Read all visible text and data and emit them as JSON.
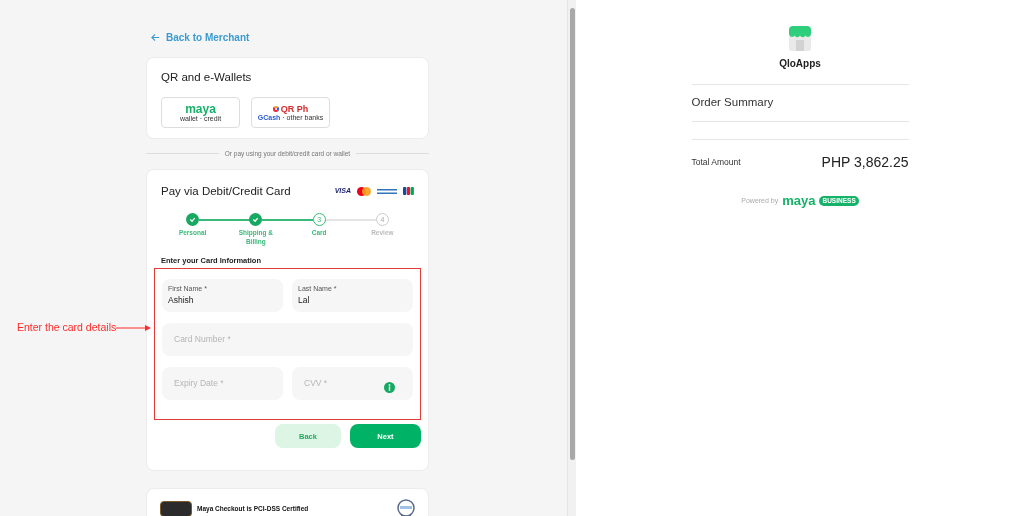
{
  "back_link": "Back to Merchant",
  "wallets": {
    "title": "QR and e-Wallets",
    "options": [
      {
        "kind": "maya",
        "brand": "maya",
        "caption": "wallet · credit"
      },
      {
        "kind": "qrph",
        "brand": "QR Ph",
        "sub_brand": "GCash",
        "caption": "· other banks"
      }
    ]
  },
  "divider_text": "Or pay using your debit/credit card or wallet",
  "card_form": {
    "title": "Pay via Debit/Credit Card",
    "visa": "VISA",
    "steps": [
      {
        "label": "Personal",
        "kind": "done"
      },
      {
        "label": "Shipping & Billing",
        "kind": "done"
      },
      {
        "label": "Card",
        "kind": "current",
        "number": "3"
      },
      {
        "label": "Review",
        "kind": "pending",
        "number": "4"
      }
    ],
    "section_title": "Enter your Card Information",
    "fields": [
      {
        "label": "First Name *",
        "value": "Ashish"
      },
      {
        "label": "Last Name *",
        "value": "Lal"
      },
      {
        "placeholder": "Card Number *"
      },
      {
        "placeholder": "Expiry Date *"
      },
      {
        "placeholder": "CVV *",
        "info": true
      }
    ],
    "buttons": [
      {
        "label": "Back",
        "kind": "secondary"
      },
      {
        "label": "Next",
        "kind": "primary"
      }
    ]
  },
  "annotation": "Enter the card details",
  "certification": {
    "title": "Maya Checkout is PCI-DSS Certified"
  },
  "summary": {
    "merchant": "QloApps",
    "heading": "Order Summary",
    "total_label": "Total Amount",
    "total_value": "PHP 3,862.25",
    "powered_by": "Powered by",
    "brand": "maya",
    "brand_badge": "BUSINESS"
  }
}
